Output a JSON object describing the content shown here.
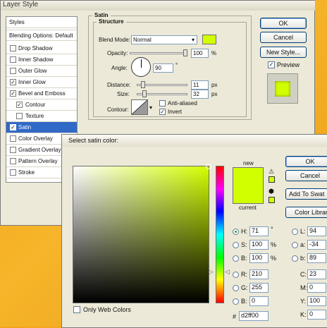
{
  "layer_style": {
    "title": "Layer Style",
    "styles_header": "Styles",
    "items": [
      {
        "label": "Blending Options: Default",
        "checkbox": false,
        "checked": false
      },
      {
        "label": "Drop Shadow",
        "checkbox": true,
        "checked": false
      },
      {
        "label": "Inner Shadow",
        "checkbox": true,
        "checked": false
      },
      {
        "label": "Outer Glow",
        "checkbox": true,
        "checked": false
      },
      {
        "label": "Inner Glow",
        "checkbox": true,
        "checked": true
      },
      {
        "label": "Bevel and Emboss",
        "checkbox": true,
        "checked": true
      },
      {
        "label": "Contour",
        "checkbox": true,
        "checked": true,
        "indent": true
      },
      {
        "label": "Texture",
        "checkbox": true,
        "checked": false,
        "indent": true
      },
      {
        "label": "Satin",
        "checkbox": true,
        "checked": true,
        "selected": true
      },
      {
        "label": "Color Overlay",
        "checkbox": true,
        "checked": false
      },
      {
        "label": "Gradient Overlay",
        "checkbox": true,
        "checked": false
      },
      {
        "label": "Pattern Overlay",
        "checkbox": true,
        "checked": false
      },
      {
        "label": "Stroke",
        "checkbox": true,
        "checked": false
      }
    ],
    "satin": {
      "heading": "Satin",
      "structure": "Structure",
      "blend_mode_label": "Blend Mode:",
      "blend_mode_value": "Normal",
      "color": "#d2ff00",
      "opacity_label": "Opacity:",
      "opacity_value": "100",
      "opacity_unit": "%",
      "angle_label": "Angle:",
      "angle_value": "90",
      "angle_unit": "°",
      "distance_label": "Distance:",
      "distance_value": "11",
      "distance_unit": "px",
      "size_label": "Size:",
      "size_value": "32",
      "size_unit": "px",
      "contour_label": "Contour:",
      "anti_aliased_label": "Anti-aliased",
      "anti_aliased": false,
      "invert_label": "Invert",
      "invert": true
    },
    "buttons": {
      "ok": "OK",
      "cancel": "Cancel",
      "new_style": "New Style...",
      "preview_label": "Preview",
      "preview_checked": true
    }
  },
  "color_picker": {
    "title": "Select satin color:",
    "new_label": "new",
    "current_label": "current",
    "new_color": "#d2ff00",
    "current_color": "#d2ff00",
    "ok": "OK",
    "cancel": "Cancel",
    "add_to_swatches": "Add To Swat",
    "color_libraries": "Color Librar",
    "only_web_colors": "Only Web Colors",
    "hex_prefix": "#",
    "hex": "d2ff00",
    "hsb": [
      {
        "label": "H:",
        "value": "71",
        "unit": "°",
        "selected": true
      },
      {
        "label": "S:",
        "value": "100",
        "unit": "%",
        "selected": false
      },
      {
        "label": "B:",
        "value": "100",
        "unit": "%",
        "selected": false
      }
    ],
    "rgb": [
      {
        "label": "R:",
        "value": "210"
      },
      {
        "label": "G:",
        "value": "255"
      },
      {
        "label": "B:",
        "value": "0"
      }
    ],
    "lab": [
      {
        "label": "L:",
        "value": "94"
      },
      {
        "label": "a:",
        "value": "-34"
      },
      {
        "label": "b:",
        "value": "89"
      }
    ],
    "cmyk": [
      {
        "label": "C:",
        "value": "23"
      },
      {
        "label": "M:",
        "value": "0"
      },
      {
        "label": "Y:",
        "value": "100"
      },
      {
        "label": "K:",
        "value": "0"
      }
    ]
  }
}
